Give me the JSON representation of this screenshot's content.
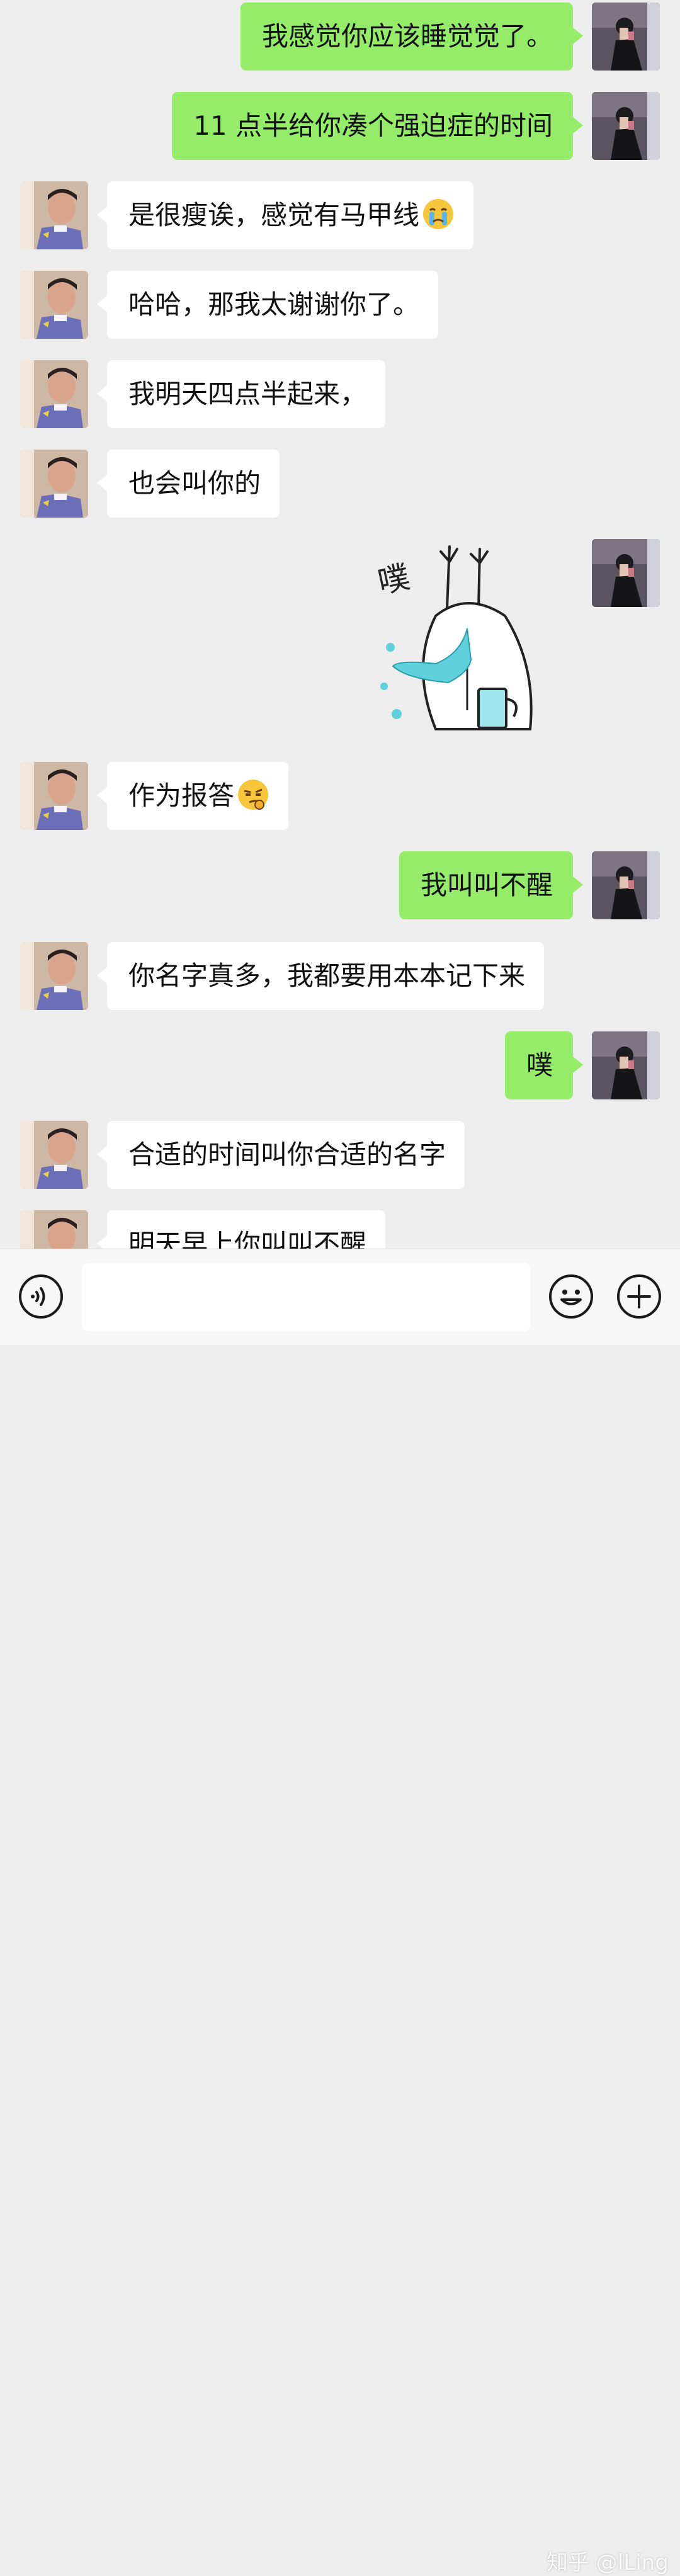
{
  "colors": {
    "background": "#ededed",
    "self_bubble": "#95ec69",
    "peer_bubble": "#ffffff",
    "bottom_bar": "#f7f7f7"
  },
  "messages": [
    {
      "from": "self",
      "text": "我感觉你应该睡觉觉了。"
    },
    {
      "from": "self",
      "text": "11 点半给你凑个强迫症的时间"
    },
    {
      "from": "peer",
      "text": "是很瘦诶，感觉有马甲线",
      "emoji": "crying-face"
    },
    {
      "from": "peer",
      "text": "哈哈，那我太谢谢你了。"
    },
    {
      "from": "peer",
      "text": "我明天四点半起来，"
    },
    {
      "from": "peer",
      "text": "也会叫你的"
    },
    {
      "from": "self",
      "type": "sticker",
      "text": "噗",
      "icon": "rabbit-spitting-water-sticker"
    },
    {
      "from": "peer",
      "text": "作为报答",
      "emoji": "smirking-face"
    },
    {
      "from": "self",
      "text": "我叫叫不醒"
    },
    {
      "from": "peer",
      "text": "你名字真多，我都要用本本记下来"
    },
    {
      "from": "self",
      "text": "噗"
    },
    {
      "from": "peer",
      "text": "合适的时间叫你合适的名字"
    },
    {
      "from": "peer",
      "text": "明天早上你叫叫不醒"
    }
  ],
  "bottom_bar": {
    "voice_icon": "voice-icon",
    "emoji_icon": "emoji-icon",
    "plus_icon": "plus-icon",
    "input_value": "",
    "input_placeholder": ""
  },
  "watermark": "知乎 @lLing"
}
